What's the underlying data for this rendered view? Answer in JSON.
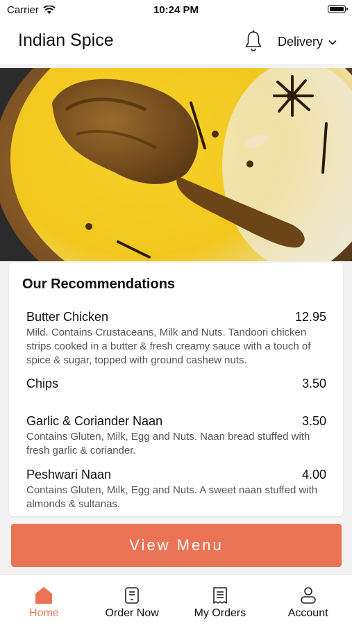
{
  "status_bar": {
    "carrier": "Carrier",
    "time": "10:24 PM"
  },
  "header": {
    "title": "Indian Spice",
    "mode": "Delivery",
    "notification_icon": "bell-icon"
  },
  "hero": {
    "alt": "Chicken biryani with yellow rice and spices"
  },
  "recommendations": {
    "heading": "Our Recommendations",
    "items": [
      {
        "name": "Butter Chicken",
        "price": "12.95",
        "description": "Mild. Contains Crustaceans, Milk and Nuts. Tandoori chicken strips cooked in a butter & fresh creamy sauce with a touch of spice & sugar, topped with ground cashew nuts."
      },
      {
        "name": "Chips",
        "price": "3.50",
        "description": ""
      },
      {
        "name": "Garlic & Coriander Naan",
        "price": "3.50",
        "description": "Contains Gluten, Milk, Egg and Nuts. Naan bread stuffed with fresh garlic & coriander."
      },
      {
        "name": "Peshwari Naan",
        "price": "4.00",
        "description": "Contains Gluten, Milk, Egg and Nuts. A sweet naan stuffed with almonds & sultanas."
      }
    ]
  },
  "cta": {
    "label": "View Menu"
  },
  "tabs": [
    {
      "label": "Home",
      "icon": "home-icon",
      "active": true
    },
    {
      "label": "Order Now",
      "icon": "order-icon",
      "active": false
    },
    {
      "label": "My Orders",
      "icon": "receipt-icon",
      "active": false
    },
    {
      "label": "Account",
      "icon": "person-icon",
      "active": false
    }
  ],
  "colors": {
    "accent": "#eb7355",
    "background": "#f3f3f3"
  }
}
